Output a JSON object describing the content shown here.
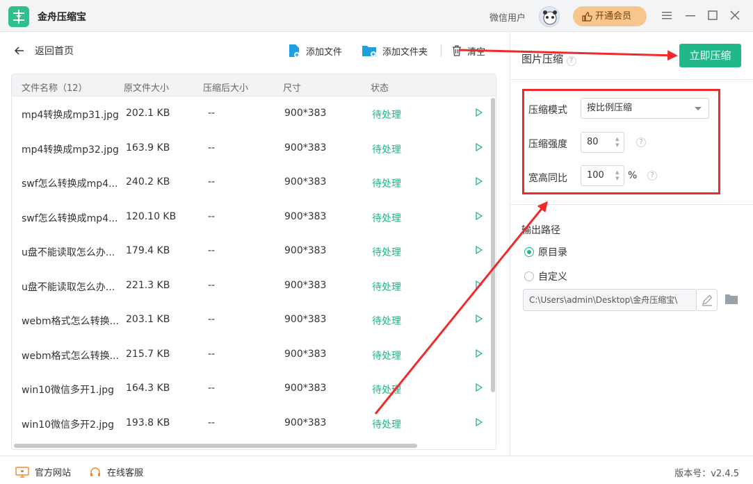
{
  "app": {
    "title": "金舟压缩宝",
    "user_name": "微信用户",
    "vip_label": "开通会员"
  },
  "toolbar": {
    "back_label": "返回首页",
    "add_file_label": "添加文件",
    "add_folder_label": "添加文件夹",
    "clear_label": "清空"
  },
  "table": {
    "headers": [
      "文件名称（12）",
      "原文件大小",
      "压缩后大小",
      "尺寸",
      "状态"
    ],
    "rows": [
      {
        "name": "mp4转换成mp31.jpg",
        "size": "202.1 KB",
        "compressed": "--",
        "dim": "900*383",
        "status": "待处理"
      },
      {
        "name": "mp4转换成mp32.jpg",
        "size": "163.9 KB",
        "compressed": "--",
        "dim": "900*383",
        "status": "待处理"
      },
      {
        "name": "swf怎么转换成mp4...",
        "size": "240.2 KB",
        "compressed": "--",
        "dim": "900*383",
        "status": "待处理"
      },
      {
        "name": "swf怎么转换成mp4...",
        "size": "120.10 KB",
        "compressed": "--",
        "dim": "900*383",
        "status": "待处理"
      },
      {
        "name": "u盘不能读取怎么办...",
        "size": "179.4 KB",
        "compressed": "--",
        "dim": "900*383",
        "status": "待处理"
      },
      {
        "name": "u盘不能读取怎么办...",
        "size": "221.3 KB",
        "compressed": "--",
        "dim": "900*383",
        "status": "待处理"
      },
      {
        "name": "webm格式怎么转换...",
        "size": "203.1 KB",
        "compressed": "--",
        "dim": "900*383",
        "status": "待处理"
      },
      {
        "name": "webm格式怎么转换...",
        "size": "215.7 KB",
        "compressed": "--",
        "dim": "900*383",
        "status": "待处理"
      },
      {
        "name": "win10微信多开1.jpg",
        "size": "164.3 KB",
        "compressed": "--",
        "dim": "900*383",
        "status": "待处理"
      },
      {
        "name": "win10微信多开2.jpg",
        "size": "193.8 KB",
        "compressed": "--",
        "dim": "900*383",
        "status": "待处理"
      }
    ]
  },
  "panel": {
    "title": "图片压缩",
    "compress_now_label": "立即压缩",
    "mode_label": "压缩模式",
    "mode_value": "按比例压缩",
    "strength_label": "压缩强度",
    "strength_value": "80",
    "ratio_label": "宽高同比",
    "ratio_value": "100",
    "ratio_unit": "%",
    "output_label": "输出路径",
    "option_original": "原目录",
    "option_custom": "自定义",
    "path_value": "C:\\Users\\admin\\Desktop\\金舟压缩宝\\",
    "help_mark": "?"
  },
  "footer": {
    "website_label": "官方网站",
    "service_label": "在线客服",
    "version_label": "版本号：v2.4.5"
  },
  "colors": {
    "accent": "#21b789",
    "status": "#1fb489",
    "vip": "#f7c58e",
    "annotation": "#ee2a2a"
  },
  "icons": [
    "app-logo-icon",
    "back-arrow-icon",
    "add-file-icon",
    "add-folder-icon",
    "trash-icon",
    "play-icon",
    "menu-icon",
    "minimize-icon",
    "maximize-icon",
    "close-icon",
    "thumb-up-icon",
    "edit-pen-icon",
    "folder-icon",
    "monitor-icon",
    "headset-icon"
  ]
}
